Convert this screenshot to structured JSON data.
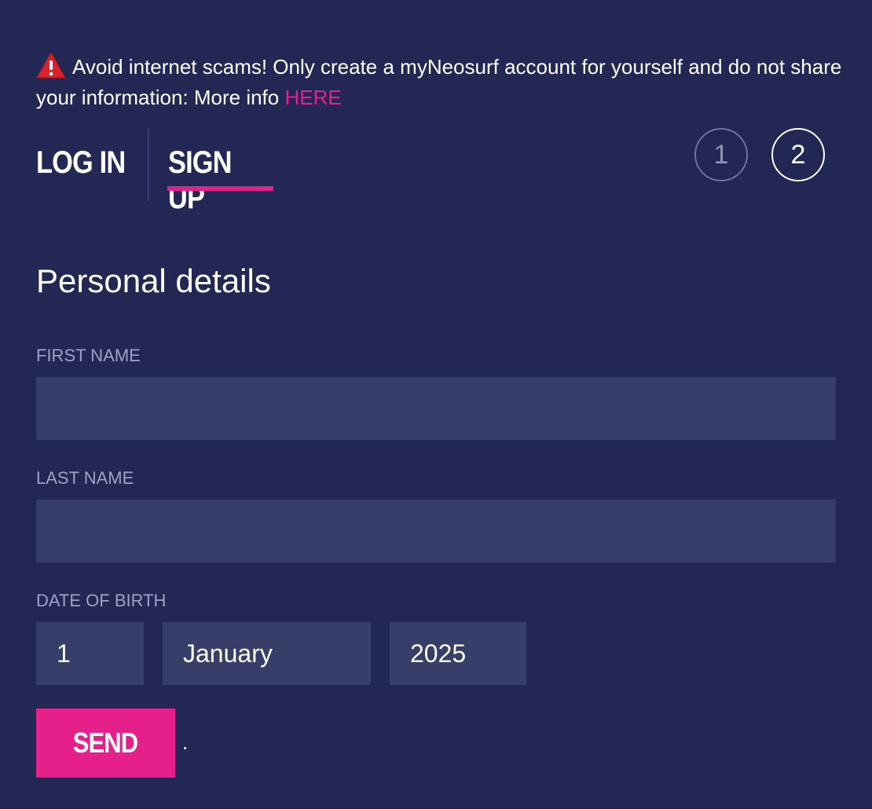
{
  "notice": {
    "icon": "warning-icon",
    "text": "Avoid internet scams! Only create a myNeosurf account for yourself and do not share your information: More info ",
    "link_label": "HERE"
  },
  "tabs": {
    "login_label": "LOG IN",
    "signup_label": "SIGN UP",
    "active": "signup"
  },
  "steps": {
    "step1_label": "1",
    "step2_label": "2",
    "current": 2
  },
  "form": {
    "title": "Personal details",
    "first_name": {
      "label": "FIRST NAME",
      "value": ""
    },
    "last_name": {
      "label": "LAST NAME",
      "value": ""
    },
    "dob": {
      "label": "DATE OF BIRTH",
      "day": "1",
      "month": "January",
      "year": "2025"
    },
    "send_label": "SEND",
    "trailing_text": "."
  },
  "colors": {
    "background": "#222754",
    "field": "#373e67",
    "accent": "#e6208a",
    "label": "#9fa3c3"
  }
}
